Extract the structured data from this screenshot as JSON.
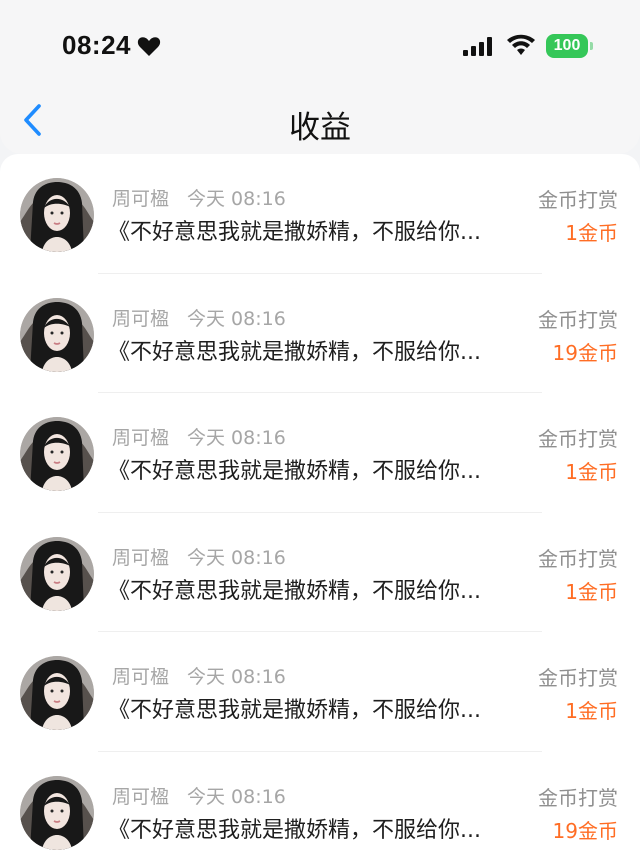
{
  "status_bar": {
    "time": "08:24",
    "battery": "100"
  },
  "header": {
    "title": "收益"
  },
  "records": [
    {
      "name": "周可楹",
      "time": "今天 08:16",
      "message": "《不好意思我就是撒娇精，不服给你...",
      "type": "金币打赏",
      "amount": "1金币"
    },
    {
      "name": "周可楹",
      "time": "今天 08:16",
      "message": "《不好意思我就是撒娇精，不服给你...",
      "type": "金币打赏",
      "amount": "19金币"
    },
    {
      "name": "周可楹",
      "time": "今天 08:16",
      "message": "《不好意思我就是撒娇精，不服给你...",
      "type": "金币打赏",
      "amount": "1金币"
    },
    {
      "name": "周可楹",
      "time": "今天 08:16",
      "message": "《不好意思我就是撒娇精，不服给你...",
      "type": "金币打赏",
      "amount": "1金币"
    },
    {
      "name": "周可楹",
      "time": "今天 08:16",
      "message": "《不好意思我就是撒娇精，不服给你...",
      "type": "金币打赏",
      "amount": "1金币"
    },
    {
      "name": "周可楹",
      "time": "今天 08:16",
      "message": "《不好意思我就是撒娇精，不服给你...",
      "type": "金币打赏",
      "amount": "19金币"
    }
  ],
  "icons": {
    "heart": "heart-icon",
    "signal": "signal-icon",
    "wifi": "wifi-icon",
    "battery": "battery-icon",
    "back": "back-arrow-icon"
  },
  "colors": {
    "accent": "#1f8cff",
    "amount": "#ff6d24",
    "battery": "#35c759"
  }
}
